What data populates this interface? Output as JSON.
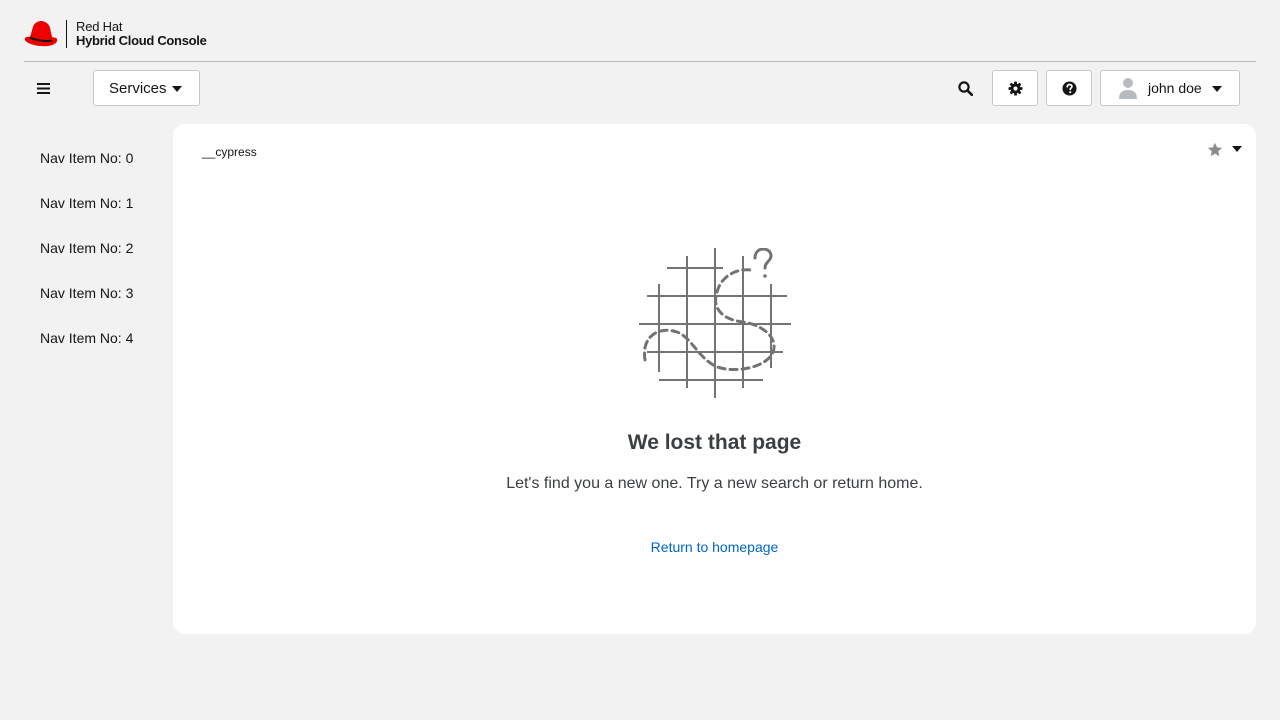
{
  "masthead": {
    "brand_line1": "Red Hat",
    "brand_line2": "Hybrid Cloud Console",
    "logo_icon": "redhat-fedora-logo",
    "services_label": "Services",
    "user_name": "john doe",
    "icons": {
      "menu": "hamburger-icon",
      "search": "search-icon",
      "settings": "gear-icon",
      "help": "question-circle-icon",
      "user": "user-avatar-icon"
    }
  },
  "sidebar": {
    "items": [
      {
        "label": "Nav Item No: 0"
      },
      {
        "label": "Nav Item No: 1"
      },
      {
        "label": "Nav Item No: 2"
      },
      {
        "label": "Nav Item No: 3"
      },
      {
        "label": "Nav Item No: 4"
      }
    ]
  },
  "page": {
    "bundle_label": "__cypress",
    "favorite_icon": "star-icon",
    "empty_state": {
      "icon": "lost-path-grid-icon",
      "title": "We lost that page",
      "body": "Let's find you a new one. Try a new search or return home.",
      "link_label": "Return to homepage"
    }
  },
  "colors": {
    "background": "#f2f2f2",
    "card": "#ffffff",
    "brand_red": "#ee0000",
    "link": "#0066cc",
    "text": "#151515",
    "muted_text": "#3c3f42"
  }
}
